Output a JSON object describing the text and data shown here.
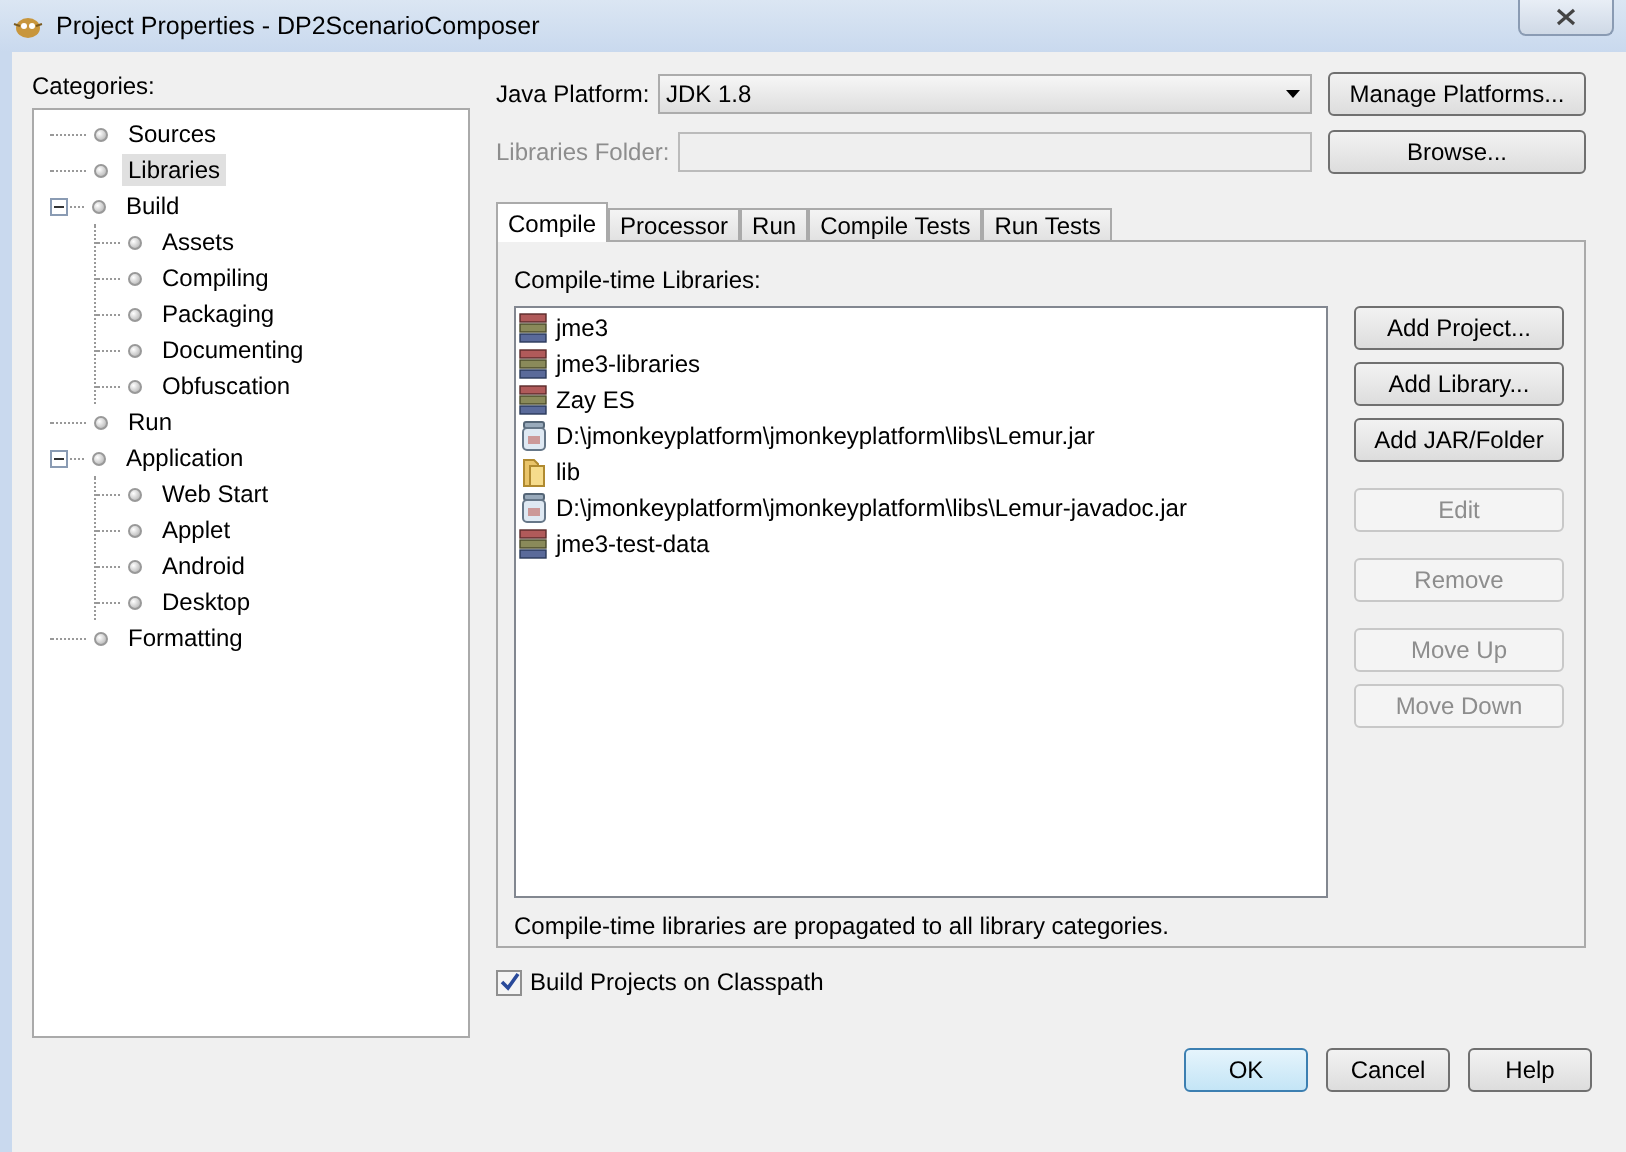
{
  "window": {
    "title": "Project Properties - DP2ScenarioComposer"
  },
  "categories": {
    "label": "Categories:",
    "items": [
      {
        "label": "Sources",
        "selected": false
      },
      {
        "label": "Libraries",
        "selected": true
      },
      {
        "label": "Build",
        "selected": false,
        "expanded": true,
        "children": [
          {
            "label": "Assets",
            "selected": false
          },
          {
            "label": "Compiling",
            "selected": false
          },
          {
            "label": "Packaging",
            "selected": false
          },
          {
            "label": "Documenting",
            "selected": false
          },
          {
            "label": "Obfuscation",
            "selected": false
          }
        ]
      },
      {
        "label": "Run",
        "selected": false
      },
      {
        "label": "Application",
        "selected": false,
        "expanded": true,
        "children": [
          {
            "label": "Web Start",
            "selected": false
          },
          {
            "label": "Applet",
            "selected": false
          },
          {
            "label": "Android",
            "selected": false
          },
          {
            "label": "Desktop",
            "selected": false
          }
        ]
      },
      {
        "label": "Formatting",
        "selected": false
      }
    ]
  },
  "java_platform": {
    "label": "Java Platform:",
    "value": "JDK 1.8",
    "button": "Manage Platforms..."
  },
  "libraries_folder": {
    "label": "Libraries Folder:",
    "disabled": true,
    "button": "Browse..."
  },
  "tabs": [
    {
      "label": "Compile",
      "selected": true
    },
    {
      "label": "Processor",
      "selected": false
    },
    {
      "label": "Run",
      "selected": false
    },
    {
      "label": "Compile Tests",
      "selected": false
    },
    {
      "label": "Run Tests",
      "selected": false
    }
  ],
  "compile": {
    "label": "Compile-time Libraries:",
    "libraries": [
      {
        "kind": "library",
        "name": "jme3"
      },
      {
        "kind": "library",
        "name": "jme3-libraries"
      },
      {
        "kind": "library",
        "name": "Zay ES"
      },
      {
        "kind": "jar",
        "name": "D:\\jmonkeyplatform\\jmonkeyplatform\\libs\\Lemur.jar"
      },
      {
        "kind": "folder",
        "name": "lib"
      },
      {
        "kind": "jar",
        "name": "D:\\jmonkeyplatform\\jmonkeyplatform\\libs\\Lemur-javadoc.jar"
      },
      {
        "kind": "library",
        "name": "jme3-test-data"
      }
    ],
    "button_groups": [
      [
        {
          "label": "Add Project...",
          "disabled": false
        },
        {
          "label": "Add Library...",
          "disabled": false
        },
        {
          "label": "Add JAR/Folder",
          "disabled": false
        }
      ],
      [
        {
          "label": "Edit",
          "disabled": true
        }
      ],
      [
        {
          "label": "Remove",
          "disabled": true
        }
      ],
      [
        {
          "label": "Move Up",
          "disabled": true
        },
        {
          "label": "Move Down",
          "disabled": true
        }
      ]
    ],
    "note": "Compile-time libraries are propagated to all library categories."
  },
  "build_projects": {
    "label": "Build Projects on Classpath",
    "checked": true
  },
  "footer_buttons": [
    {
      "label": "OK",
      "default": true
    },
    {
      "label": "Cancel",
      "default": false
    },
    {
      "label": "Help",
      "default": false
    }
  ]
}
